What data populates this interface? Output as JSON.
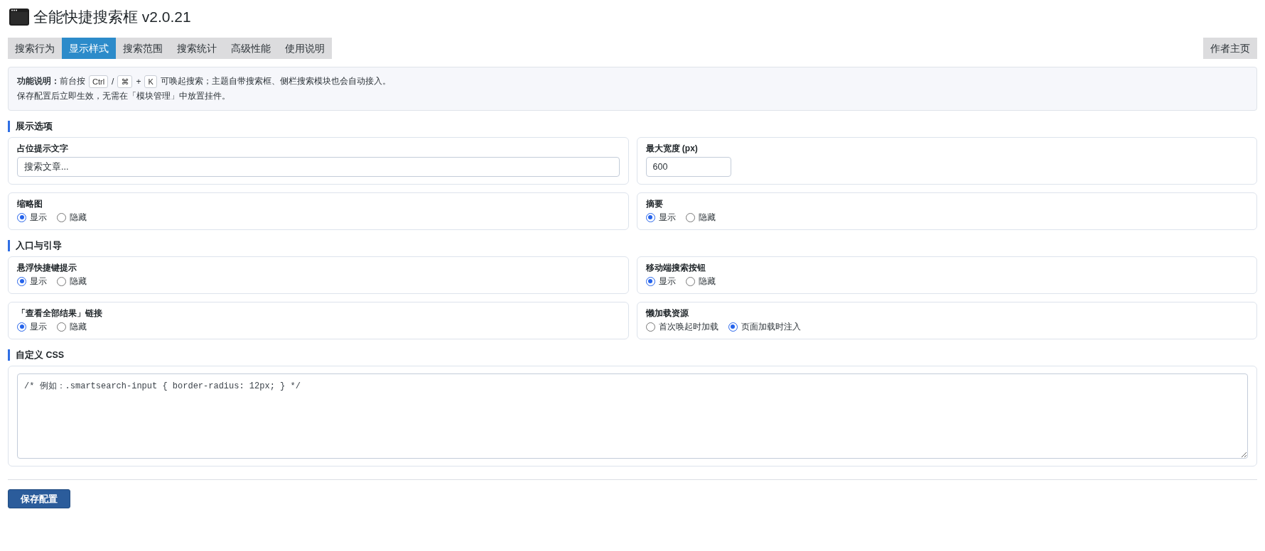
{
  "header": {
    "title": "全能快捷搜索框 v2.0.21"
  },
  "tabs": [
    {
      "label": "搜索行为",
      "selected": false
    },
    {
      "label": "显示样式",
      "selected": true
    },
    {
      "label": "搜索范围",
      "selected": false
    },
    {
      "label": "搜索统计",
      "selected": false
    },
    {
      "label": "高级性能",
      "selected": false
    },
    {
      "label": "使用说明",
      "selected": false
    }
  ],
  "author_link": {
    "label": "作者主页"
  },
  "notice": {
    "lines": [
      [
        {
          "kind": "text",
          "text": "**功能说明：**前台按"
        },
        {
          "kind": "key",
          "text": "Ctrl"
        },
        {
          "kind": "text",
          "text": "/"
        },
        {
          "kind": "key",
          "text": "⌘"
        },
        {
          "kind": "text",
          "text": "+"
        },
        {
          "kind": "key",
          "text": "K"
        },
        {
          "kind": "text",
          "text": "可唤起搜索；主题自带搜索框、侧栏搜索模块也会自动接入。"
        }
      ],
      [
        {
          "kind": "text",
          "text": "保存配置后立即生效，无需在「模块管理」中放置挂件。"
        }
      ]
    ]
  },
  "sections": [
    {
      "title": "展示选项",
      "fields": [
        {
          "kind": "text",
          "label": "占位提示文字",
          "value": "搜索文章..."
        },
        {
          "kind": "number",
          "label": "最大宽度 (px)",
          "value": "600"
        },
        {
          "kind": "radio",
          "label": "缩略图",
          "options": [
            {
              "label": "显示",
              "selected": true
            },
            {
              "label": "隐藏",
              "selected": false
            }
          ]
        },
        {
          "kind": "radio",
          "label": "摘要",
          "options": [
            {
              "label": "显示",
              "selected": true
            },
            {
              "label": "隐藏",
              "selected": false
            }
          ]
        }
      ]
    },
    {
      "title": "入口与引导",
      "fields": [
        {
          "kind": "radio",
          "label": "悬浮快捷键提示",
          "options": [
            {
              "label": "显示",
              "selected": true
            },
            {
              "label": "隐藏",
              "selected": false
            }
          ]
        },
        {
          "kind": "radio",
          "label": "移动端搜索按钮",
          "options": [
            {
              "label": "显示",
              "selected": true
            },
            {
              "label": "隐藏",
              "selected": false
            }
          ]
        },
        {
          "kind": "radio",
          "label": "「查看全部结果」链接",
          "options": [
            {
              "label": "显示",
              "selected": true
            },
            {
              "label": "隐藏",
              "selected": false
            }
          ]
        },
        {
          "kind": "radio",
          "label": "懒加载资源",
          "options": [
            {
              "label": "首次唤起时加载",
              "selected": false
            },
            {
              "label": "页面加载时注入",
              "selected": true
            }
          ]
        }
      ]
    },
    {
      "title": "自定义 CSS",
      "fields": [
        {
          "kind": "textarea",
          "placeholder": "/* 例如：.smartsearch-input { border-radius: 12px; } */"
        }
      ]
    }
  ],
  "save_button": {
    "label": "保存配置"
  }
}
